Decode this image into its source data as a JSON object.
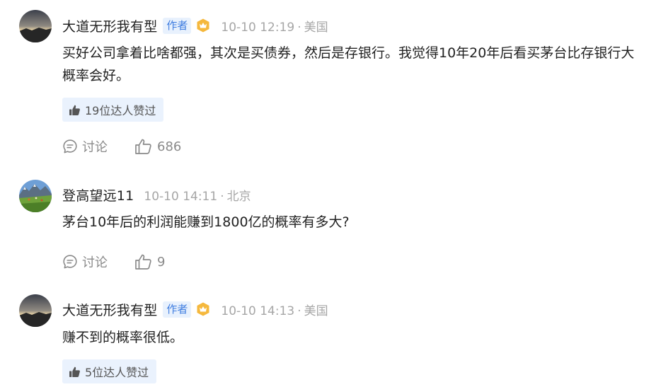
{
  "comments": [
    {
      "user": "大道无形我有型",
      "author_tag": "作者",
      "time": "10-10 12:19",
      "location": "美国",
      "separator": "·",
      "text": "买好公司拿着比啥都强，其次是买债券，然后是存银行。我觉得10年20年后看买茅台比存银行大概率会好。",
      "likers": "19位达人赞过",
      "discuss_label": "讨论",
      "like_count": "686",
      "icons": {
        "vip": "vip-crown-icon",
        "discuss": "comment-bubble-icon",
        "like": "thumbs-up-icon"
      }
    },
    {
      "user": "登高望远11",
      "time": "10-10 14:11",
      "location": "北京",
      "separator": "·",
      "text": "茅台10年后的利润能赚到1800亿的概率有多大?",
      "discuss_label": "讨论",
      "like_count": "9"
    },
    {
      "user": "大道无形我有型",
      "author_tag": "作者",
      "time": "10-10 14:13",
      "location": "美国",
      "separator": "·",
      "text": "赚不到的概率很低。",
      "likers": "5位达人赞过"
    }
  ],
  "colors": {
    "accent": "#3f7de0",
    "author_tag_bg": "#e8f1fd",
    "likers_bg": "#eaf2fd",
    "meta_text": "#a6a6a6",
    "action_text": "#8a8a8a",
    "vip_gold": "#f5b83d"
  }
}
